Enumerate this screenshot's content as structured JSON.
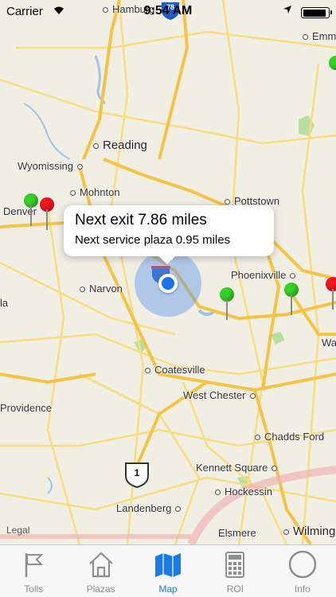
{
  "status_bar": {
    "carrier": "Carrier",
    "time": "9:54 AM",
    "battery_level": 0.95
  },
  "map": {
    "highway_shield": "78",
    "route_shield": "1",
    "places": {
      "hamburg": "Hamburg",
      "emm": "Emm",
      "reading": "Reading",
      "wyomissing": "Wyomissing",
      "mohnton": "Mohnton",
      "denver": "Denver",
      "pottstown": "Pottstown",
      "phoenixville": "Phoenixville",
      "narvon": "Narvon",
      "la": "la",
      "wa": "Wa",
      "coatesville": "Coatesville",
      "west_chester": "West Chester",
      "providence": "Providence",
      "chadds_ford": "Chadds Ford",
      "kennett_square": "Kennett Square",
      "hockessin": "Hockessin",
      "landenberg": "Landenberg",
      "elsmere": "Elsmere",
      "wilming": "Wilming"
    },
    "legal": "Legal",
    "callout": {
      "next_exit": "Next exit 7.86 miles",
      "next_service_plaza": "Next service plaza 0.95 miles"
    },
    "colors": {
      "land": "#f1eee4",
      "road_major": "#f5c342",
      "road_minor": "#f8dc7e",
      "water": "#9fc4e8",
      "park": "#b9dfa0",
      "pin_green": "#35d226",
      "pin_red": "#f2141e",
      "user_location": "#1a73e8"
    }
  },
  "tab_bar": {
    "tabs": [
      {
        "label": "Tolls",
        "icon": "flag-icon",
        "active": false
      },
      {
        "label": "Plazas",
        "icon": "house-icon",
        "active": false
      },
      {
        "label": "Map",
        "icon": "map-icon",
        "active": true
      },
      {
        "label": "ROI",
        "icon": "calculator-icon",
        "active": false
      },
      {
        "label": "Info",
        "icon": "circle-icon",
        "active": false
      }
    ],
    "active_color": "#1a7ae8",
    "inactive_color": "#8e8e8e"
  }
}
